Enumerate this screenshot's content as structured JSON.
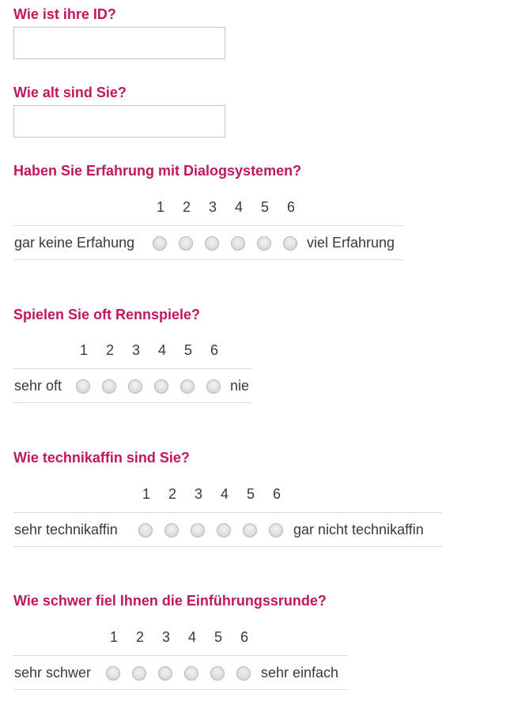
{
  "form": {
    "id_question": "Wie ist ihre ID?",
    "id_value": "",
    "age_question": "Wie alt sind Sie?",
    "age_value": "",
    "scale_numbers": [
      "1",
      "2",
      "3",
      "4",
      "5",
      "6"
    ],
    "likert": [
      {
        "question": "Haben Sie Erfahrung mit Dialogsystemen?",
        "left_label": "gar keine Erfahung",
        "right_label": "viel Erfahrung",
        "selected": null
      },
      {
        "question": "Spielen Sie oft Rennspiele?",
        "left_label": "sehr oft",
        "right_label": "nie",
        "selected": null
      },
      {
        "question": "Wie technikaffin sind Sie?",
        "left_label": "sehr technikaffin",
        "right_label": "gar nicht technikaffin",
        "selected": null
      },
      {
        "question": "Wie schwer fiel Ihnen die Einführungssrunde?",
        "left_label": "sehr schwer",
        "right_label": "sehr einfach",
        "selected": null
      }
    ]
  }
}
